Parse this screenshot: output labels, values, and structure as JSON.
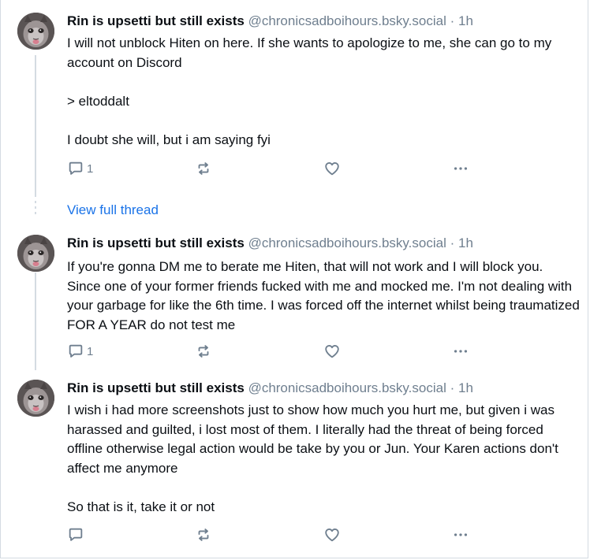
{
  "posts": [
    {
      "author": "Rin is upsetti but still exists",
      "handle": "@chronicsadboihours.bsky.social",
      "separator": "·",
      "time": "1h",
      "paragraphs": [
        "I will not unblock Hiten on here. If she wants to apologize to me, she can go to my account on Discord",
        "> eltoddalt",
        "I doubt she will, but i am saying fyi"
      ],
      "reply_count": "1",
      "icons": {
        "reply": "reply-icon",
        "repost": "repost-icon",
        "like": "heart-icon",
        "more": "more-icon"
      }
    },
    {
      "author": "Rin is upsetti but still exists",
      "handle": "@chronicsadboihours.bsky.social",
      "separator": "·",
      "time": "1h",
      "paragraphs": [
        "If you're gonna DM me to berate me Hiten, that will not work and I will block you. Since one of your former friends fucked with me and mocked me. I'm not dealing with your garbage for like the 6th time. I was forced off the internet whilst being traumatized FOR A YEAR do not test me"
      ],
      "reply_count": "1",
      "icons": {
        "reply": "reply-icon",
        "repost": "repost-icon",
        "like": "heart-icon",
        "more": "more-icon"
      }
    },
    {
      "author": "Rin is upsetti but still exists",
      "handle": "@chronicsadboihours.bsky.social",
      "separator": "·",
      "time": "1h",
      "paragraphs": [
        "I wish i had more screenshots just to show how much you hurt me, but given i was harassed and guilted, i lost most of them. I literally had the threat of being forced offline otherwise legal action would be take by you or Jun. Your Karen actions don't affect me anymore",
        "So that is it, take it or not"
      ],
      "reply_count": "",
      "icons": {
        "reply": "reply-icon",
        "repost": "repost-icon",
        "like": "heart-icon",
        "more": "more-icon"
      }
    }
  ],
  "view_full_thread": "View full thread",
  "colors": {
    "text": "#0b0f14",
    "muted": "#6f7f8f",
    "link": "#1a73e8",
    "border": "#d4dbe2"
  }
}
